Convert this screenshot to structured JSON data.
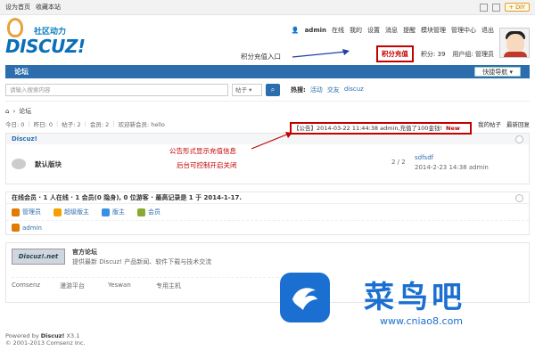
{
  "topbar": {
    "links": [
      "设为首页",
      "收藏本站"
    ],
    "diy": "DIY"
  },
  "logo": {
    "tag": "社区动力",
    "word": "DISCUZ!"
  },
  "usernav": {
    "username": "admin",
    "status": "在线",
    "items": [
      "我的",
      "设置",
      "消息",
      "提醒",
      "模块管理",
      "管理中心",
      "退出"
    ]
  },
  "usernav2": {
    "points_btn": "积分充值",
    "points": "积分: 39",
    "group": "用户组: 管理员"
  },
  "annotations": {
    "points_entry": "积分充值入口",
    "notice_line1": "公告形式显示充值信息",
    "notice_line2": "后台可控制开启关闭"
  },
  "nav": {
    "tab": "论坛",
    "quick": "快捷导航"
  },
  "search": {
    "placeholder": "请输入搜索内容",
    "select": "帖子",
    "hot_label": "热搜:",
    "hot": [
      "活动",
      "交友",
      "discuz"
    ]
  },
  "crumb": "论坛",
  "stats": {
    "today": "今日: 0",
    "yesterday": "昨日: 0",
    "posts": "帖子: 2",
    "members": "会员: 2",
    "welcome": "欢迎新会员: hello",
    "links": [
      "我的帖子",
      "最新回复"
    ]
  },
  "announcement": {
    "text": "【公告】2014-03-22 11:44:38 admin,充值了100金钱!",
    "badge": "New"
  },
  "forum_section": {
    "title": "Discuz!",
    "forum_name": "默认版块",
    "count": "2 / 2",
    "last_title": "sdfsdf",
    "last_time": "2014-2-23 14:38 admin"
  },
  "online": {
    "header": "在线会员 · 1 人在线 · 1 会员(0 隐身), 0 位游客 · 最高记录是 1 于 2014-1-17.",
    "legend": [
      "管理员",
      "超级版主",
      "版主",
      "会员"
    ],
    "users": [
      "admin"
    ]
  },
  "links_section": {
    "logo": "Discuz!.net",
    "title": "官方论坛",
    "desc": "提供最新 Discuz! 产品新闻、软件下载与技术交流",
    "row": [
      "Comsenz",
      "漫游平台",
      "Yeswan",
      "专用主机"
    ]
  },
  "footer": {
    "line1_prefix": "Powered by ",
    "line1_brand": "Discuz!",
    "line1_version": " X3.1",
    "line2": "© 2001-2013 Comsenz Inc."
  },
  "watermark": {
    "brand": "菜鸟吧",
    "url": "www.cniao8.com"
  },
  "colors": {
    "accent": "#2b6dad",
    "alert": "#c40000",
    "brand": "#1a6fd0"
  }
}
